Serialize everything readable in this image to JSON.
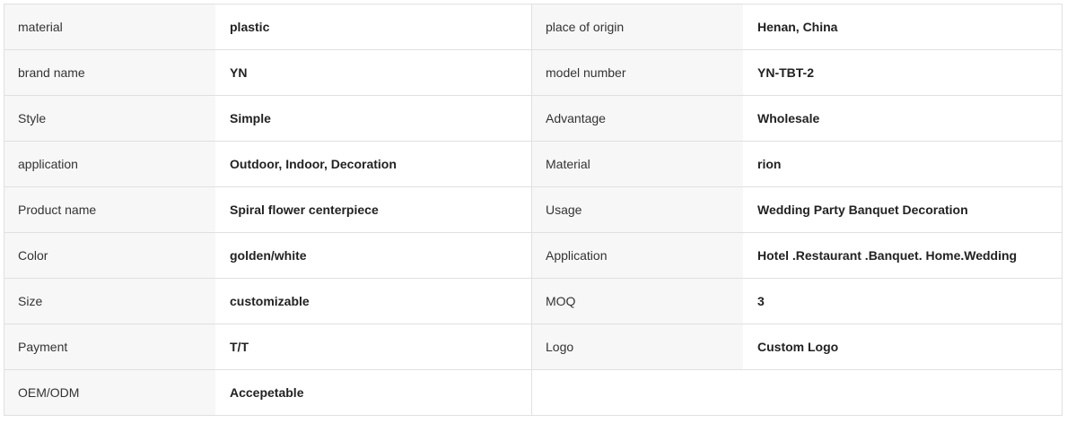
{
  "specs": {
    "rows": [
      [
        {
          "label": "material",
          "value": "plastic"
        },
        {
          "label": "place of origin",
          "value": "Henan, China"
        }
      ],
      [
        {
          "label": "brand name",
          "value": "YN"
        },
        {
          "label": "model number",
          "value": "YN-TBT-2"
        }
      ],
      [
        {
          "label": "Style",
          "value": "Simple"
        },
        {
          "label": "Advantage",
          "value": "Wholesale"
        }
      ],
      [
        {
          "label": "application",
          "value": "Outdoor, Indoor, Decoration"
        },
        {
          "label": "Material",
          "value": "rion"
        }
      ],
      [
        {
          "label": "Product name",
          "value": "Spiral flower centerpiece"
        },
        {
          "label": "Usage",
          "value": "Wedding Party Banquet Decoration"
        }
      ],
      [
        {
          "label": "Color",
          "value": "golden/white"
        },
        {
          "label": "Application",
          "value": "Hotel .Restaurant .Banquet. Home.Wedding"
        }
      ],
      [
        {
          "label": "Size",
          "value": "customizable"
        },
        {
          "label": "MOQ",
          "value": "3"
        }
      ],
      [
        {
          "label": "Payment",
          "value": "T/T"
        },
        {
          "label": "Logo",
          "value": "Custom Logo"
        }
      ],
      [
        {
          "label": "OEM/ODM",
          "value": "Accepetable"
        },
        {
          "label": "",
          "value": ""
        }
      ]
    ]
  }
}
